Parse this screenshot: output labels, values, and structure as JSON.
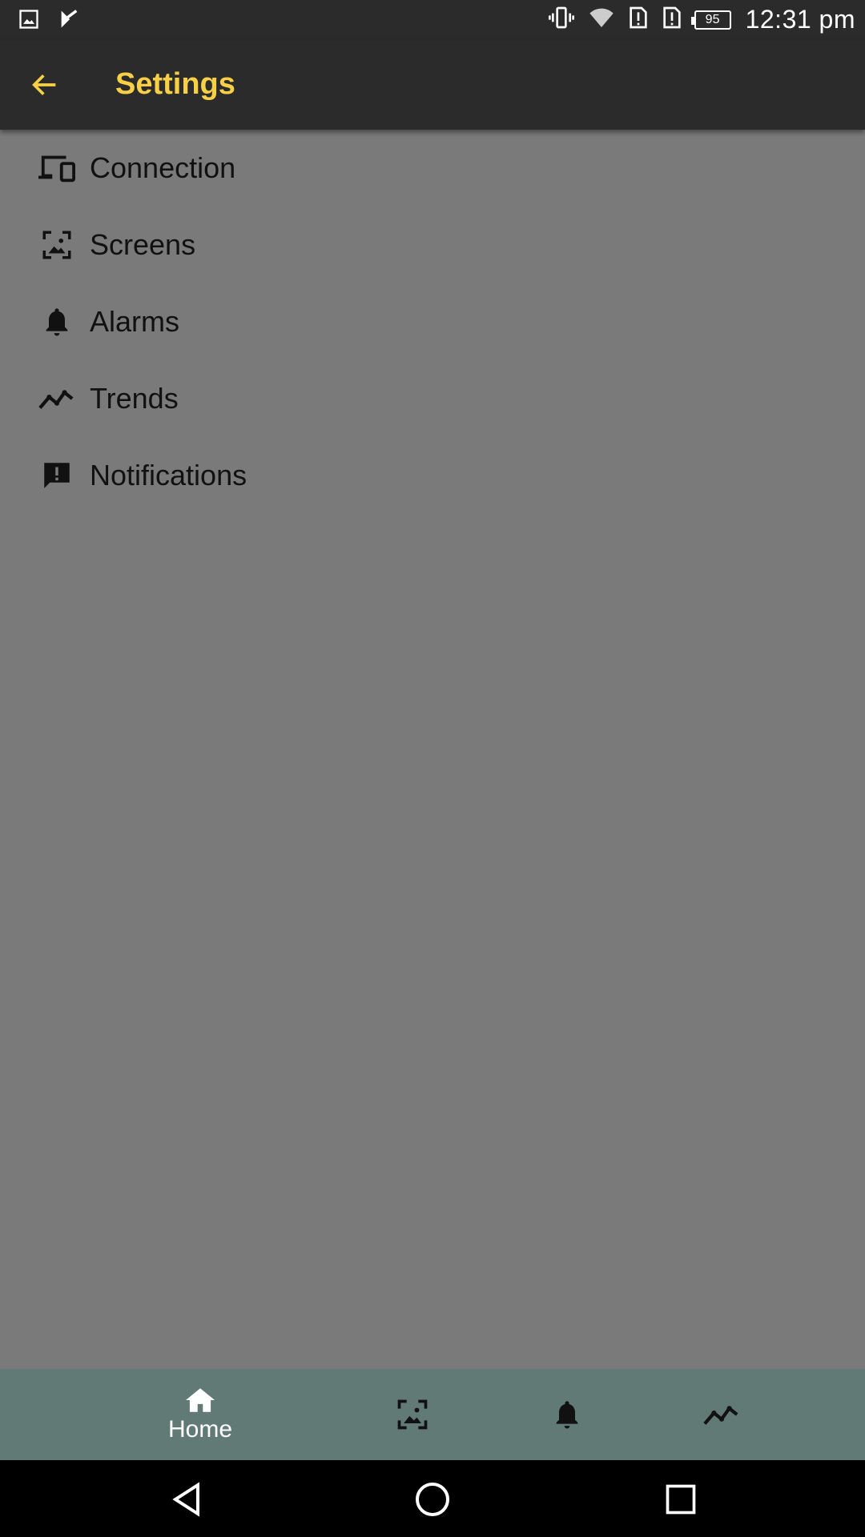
{
  "status_bar": {
    "time": "12:31 pm",
    "battery_level": "95",
    "left_icons": [
      "image-icon",
      "play-store-icon"
    ],
    "right_icons": [
      "vibrate-icon",
      "wifi-icon",
      "alert-sim-icon",
      "alert-sim-icon",
      "battery-icon"
    ]
  },
  "toolbar": {
    "title": "Settings",
    "title_color": "#f7d046",
    "back_icon": "arrow-back-icon"
  },
  "menu": {
    "items": [
      {
        "label": "Connection",
        "icon": "devices-icon"
      },
      {
        "label": "Screens",
        "icon": "screens-icon"
      },
      {
        "label": "Alarms",
        "icon": "bell-icon"
      },
      {
        "label": "Trends",
        "icon": "trend-line-icon"
      },
      {
        "label": "Notifications",
        "icon": "feedback-icon"
      }
    ]
  },
  "bottom_nav": {
    "items": [
      {
        "label": "Home",
        "icon": "home-icon",
        "active": true
      },
      {
        "label": "",
        "icon": "screens-icon"
      },
      {
        "label": "",
        "icon": "bell-icon"
      },
      {
        "label": "",
        "icon": "trend-line-icon"
      }
    ],
    "background": "#627a76"
  },
  "system_nav": {
    "buttons": [
      "back-triangle-icon",
      "home-circle-icon",
      "recents-square-icon"
    ]
  }
}
